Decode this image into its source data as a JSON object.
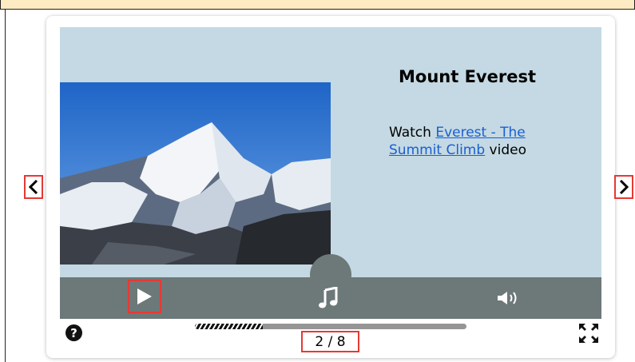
{
  "slide": {
    "title": "Mount Everest",
    "desc_prefix": "Watch ",
    "link_text": "Everest - The Summit Climb",
    "desc_suffix": " video",
    "image_icon": "mountain-photo"
  },
  "controls": {
    "play_icon": "play-icon",
    "music_icon": "music-note-icon",
    "volume_icon": "volume-icon"
  },
  "navigation": {
    "prev_icon": "chevron-left-icon",
    "next_icon": "chevron-right-icon"
  },
  "footer": {
    "help_icon": "help-icon",
    "help_glyph": "?",
    "counter": "2 / 8",
    "current_slide": 2,
    "total_slides": 8,
    "progress_fraction": 0.25,
    "fullscreen_icon": "fullscreen-icon"
  },
  "colors": {
    "slide_bg": "#c4d9e3",
    "controls_bg": "#6d7879",
    "highlight": "#e53935",
    "link": "#1a5fd0",
    "top_bar": "#fdecc3"
  }
}
